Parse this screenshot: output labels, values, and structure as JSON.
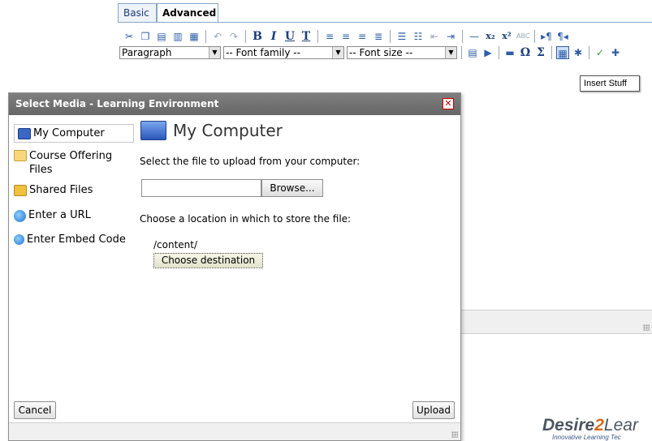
{
  "editor": {
    "tabs": [
      {
        "label": "Basic",
        "active": false
      },
      {
        "label": "Advanced",
        "active": true
      }
    ],
    "toolbar_row1": [
      "cut-icon",
      "copy-icon",
      "paste-icon",
      "paste-text-icon",
      "paste-word-icon",
      "undo-icon",
      "redo-icon",
      "bold-icon",
      "italic-icon",
      "underline-icon",
      "text-color-icon",
      "align-left-icon",
      "align-center-icon",
      "align-right-icon",
      "justify-icon",
      "bullet-list-icon",
      "numbered-list-icon",
      "outdent-icon",
      "indent-icon",
      "horizontal-rule-icon",
      "subscript-icon",
      "superscript-icon",
      "strikethrough-icon",
      "ltr-icon",
      "rtl-icon"
    ],
    "format_select": "Paragraph",
    "font_family_select": "-- Font family --",
    "font_size_select": "-- Font size --",
    "tooltip": "Insert Stuff"
  },
  "dialog": {
    "title": "Select Media - Learning Environment",
    "nav": [
      {
        "label": "My Computer",
        "icon": "monitor-icon",
        "selected": true
      },
      {
        "label": "Course Offering Files",
        "icon": "folder-icon",
        "selected": false
      },
      {
        "label": "Shared Files",
        "icon": "shared-files-icon",
        "selected": false
      },
      {
        "label": "Enter a URL",
        "icon": "globe-icon",
        "selected": false
      },
      {
        "label": "Enter Embed Code",
        "icon": "embed-code-icon",
        "selected": false
      }
    ],
    "content": {
      "heading": "My Computer",
      "select_prompt": "Select the file to upload from your computer:",
      "file_value": "",
      "browse_label": "Browse...",
      "location_prompt": "Choose a location in which to store the file:",
      "location_path": "/content/",
      "choose_label": "Choose destination"
    },
    "cancel_label": "Cancel",
    "upload_label": "Upload"
  },
  "brand": {
    "name_part1": "Desire",
    "name_part2": "2",
    "name_part3": "Lear",
    "tagline": "Innovative Learning Tec"
  },
  "colors": {
    "title_bar": "#6f6f6f",
    "tab_border": "#8aa6c8",
    "brand_accent": "#d46b1d"
  }
}
